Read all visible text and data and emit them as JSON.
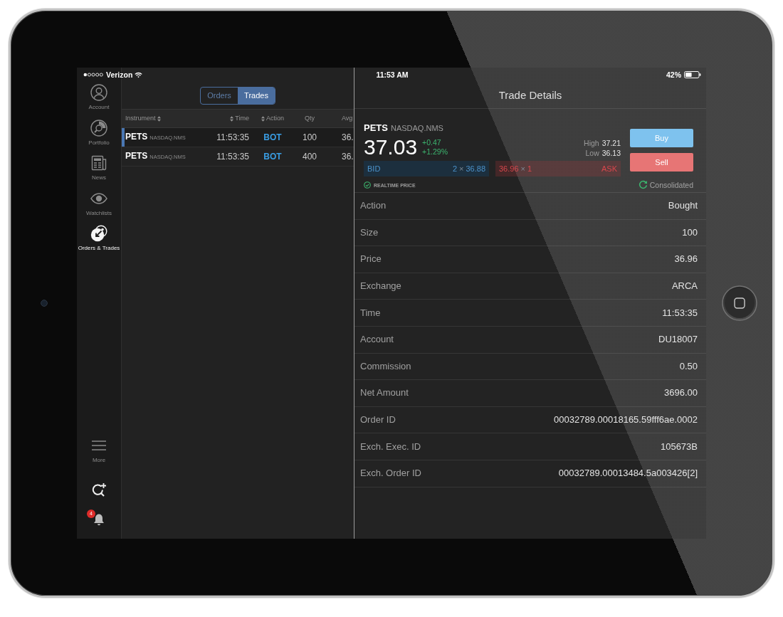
{
  "status_bar": {
    "carrier": "Verizon",
    "time": "11:53 AM",
    "battery": "42%"
  },
  "sidebar": {
    "items": [
      {
        "label": "Account",
        "selected": false
      },
      {
        "label": "Portfolio",
        "selected": false
      },
      {
        "label": "News",
        "selected": false
      },
      {
        "label": "Watchlists",
        "selected": false
      },
      {
        "label": "Orders & Trades",
        "selected": true
      }
    ],
    "more": {
      "label": "More"
    },
    "notifications": {
      "badge": "4"
    }
  },
  "segments": [
    {
      "label": "Orders",
      "selected": false
    },
    {
      "label": "Trades",
      "selected": true
    }
  ],
  "table": {
    "columns": [
      {
        "label": "Instrument",
        "sortable": true
      },
      {
        "label": "Time",
        "sortable": true
      },
      {
        "label": "Action",
        "sortable": true
      },
      {
        "label": "Qty",
        "sortable": false
      },
      {
        "label": "Avg",
        "sortable": false
      }
    ],
    "rows": [
      {
        "symbol": "PETS",
        "exchange": "NASDAQ.NMS",
        "time": "11:53:35",
        "action": "BOT",
        "qty": "100",
        "avg": "36.",
        "selected": true
      },
      {
        "symbol": "PETS",
        "exchange": "NASDAQ.NMS",
        "time": "11:53:35",
        "action": "BOT",
        "qty": "400",
        "avg": "36.",
        "selected": false
      }
    ]
  },
  "details": {
    "title": "Trade Details",
    "quote": {
      "symbol": "PETS",
      "exchange": "NASDAQ.NMS",
      "last": "37.03",
      "change": "+0.47",
      "change_percent": "+1.29%",
      "gain": true,
      "high_label": "High",
      "high": "37.21",
      "low_label": "Low",
      "low": "36.13",
      "bid_label": "BID",
      "bid_size": "2",
      "bid_times": "×",
      "bid": "36.88",
      "ask": "36.96",
      "ask_times": "×",
      "ask_size": "1",
      "ask_label": "ASK",
      "realtime_label": "REALTIME PRICE",
      "source": "Consolidated"
    },
    "buttons": [
      {
        "label": "Buy",
        "kind": "buy"
      },
      {
        "label": "Sell",
        "kind": "sell"
      }
    ],
    "rows": [
      {
        "label": "Action",
        "value": "Bought"
      },
      {
        "label": "Size",
        "value": "100"
      },
      {
        "label": "Price",
        "value": "36.96"
      },
      {
        "label": "Exchange",
        "value": "ARCA"
      },
      {
        "label": "Time",
        "value": "11:53:35"
      },
      {
        "label": "Account",
        "value": "DU18007"
      },
      {
        "label": "Commission",
        "value": "0.50"
      },
      {
        "label": "Net Amount",
        "value": "3696.00"
      },
      {
        "label": "Order ID",
        "value": "00032789.00018165.59fff6ae.0002"
      },
      {
        "label": "Exch. Exec. ID",
        "value": "105673B"
      },
      {
        "label": "Exch. Order ID",
        "value": "00032789.00013484.5a003426[2]"
      }
    ]
  }
}
